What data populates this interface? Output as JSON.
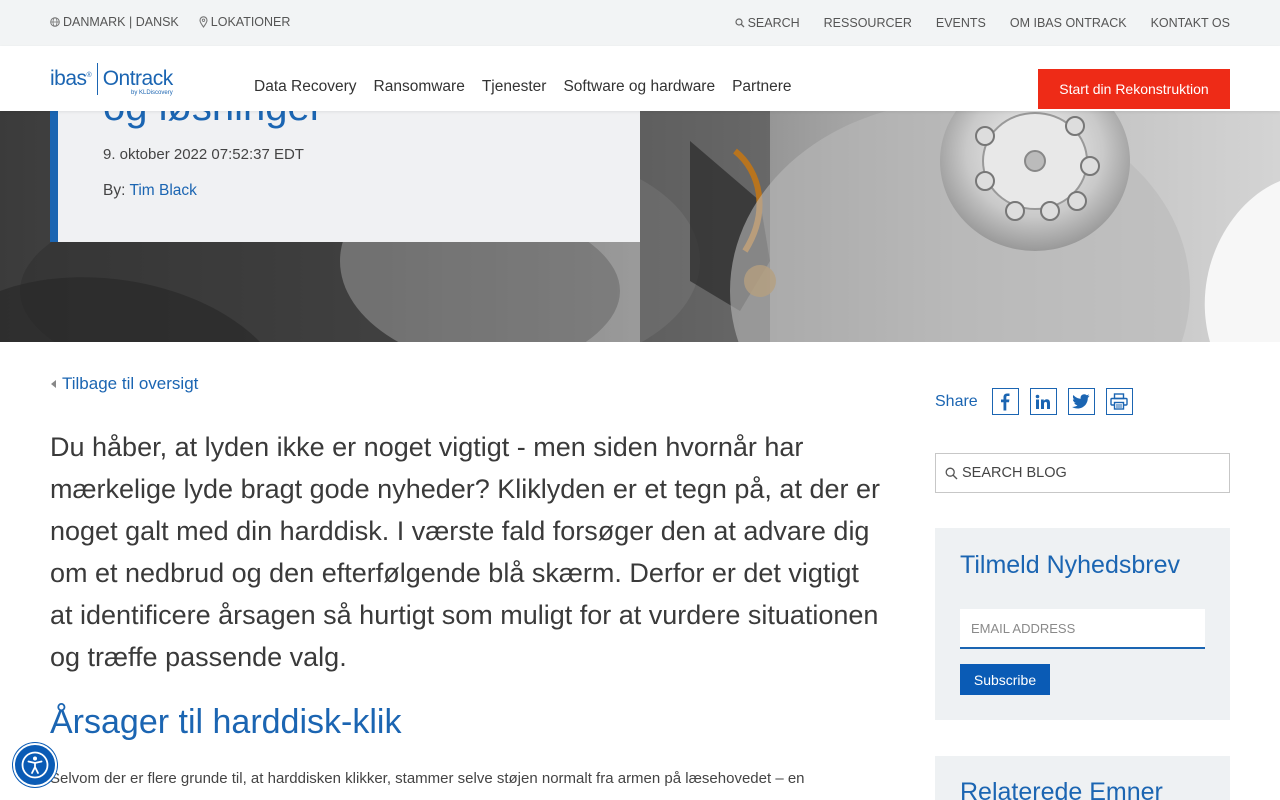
{
  "utility": {
    "region_label": "DANMARK | DANSK",
    "locations_label": "LOKATIONER",
    "search_label": "SEARCH",
    "links": [
      "RESSOURCER",
      "EVENTS",
      "OM IBAS ONTRACK",
      "KONTAKT OS"
    ]
  },
  "header": {
    "logo_ibas": "ibas",
    "logo_ontrack": "Ontrack",
    "logo_by": "by KLDiscovery",
    "nav": [
      "Data Recovery",
      "Ransomware",
      "Tjenester",
      "Software og hardware",
      "Partnere"
    ],
    "cta_label": "Start din Rekonstruktion"
  },
  "hero": {
    "title_fragment": "og løsninger",
    "date": "9. oktober 2022 07:52:37 EDT",
    "author_prefix": "By:",
    "author_name": "Tim Black"
  },
  "article": {
    "back_link": "Tilbage til oversigt",
    "lead": "Du håber, at lyden ikke er noget vigtigt - men siden hvornår har mærkelige lyde bragt gode nyheder? Kliklyden er et tegn på, at der er noget galt med din harddisk. I værste fald forsøger den at advare dig om et nedbrud og den efterfølgende blå skærm. Derfor er det vigtigt at identificere årsagen så hurtigt som muligt for at vurdere situationen og træffe passende valg.",
    "section_heading": "Årsager til harddisk-klik",
    "body_start": "Selvom der er flere grunde til, at harddisken klikker, stammer selve støjen normalt fra armen på læsehovedet – en"
  },
  "sidebar": {
    "share_label": "Share",
    "share_icons": [
      "facebook-icon",
      "linkedin-icon",
      "twitter-icon",
      "print-icon"
    ],
    "search_placeholder": "SEARCH BLOG",
    "newsletter_title": "Tilmeld Nyhedsbrev",
    "email_placeholder": "EMAIL ADDRESS",
    "subscribe_label": "Subscribe",
    "related_title": "Relaterede Emner"
  },
  "colors": {
    "brand_blue": "#1b65b2",
    "cta_red": "#ee2b17",
    "panel_gray": "#eef1f3"
  }
}
